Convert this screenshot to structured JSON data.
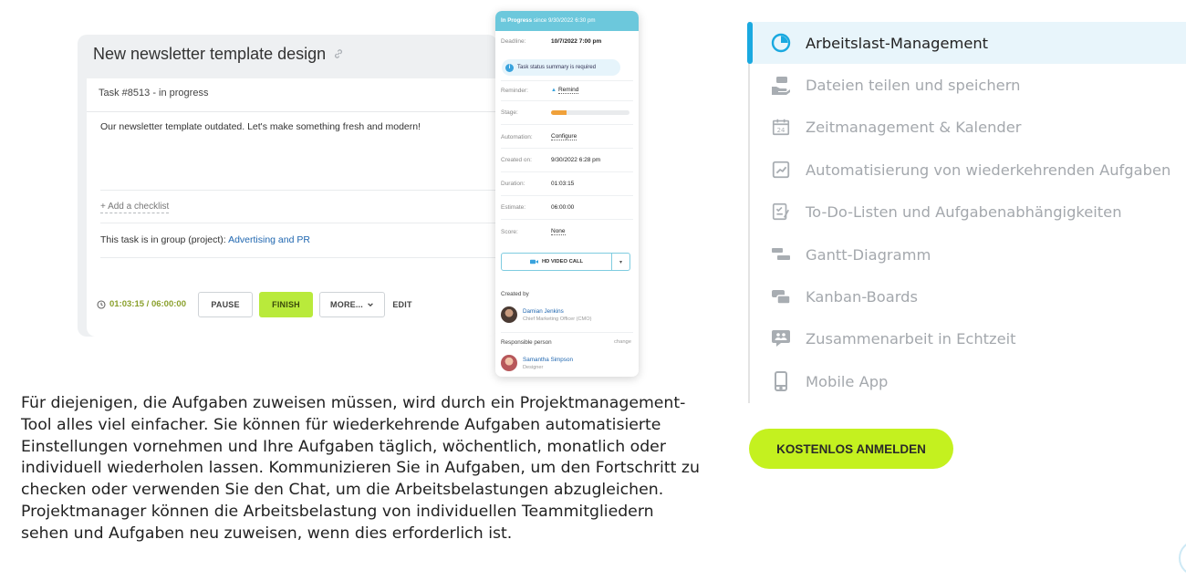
{
  "task": {
    "title": "New newsletter template design",
    "header": "Task #8513 - in progress",
    "description": "Our newsletter template outdated. Let's make something fresh and modern!",
    "add_checklist": "+ Add a checklist",
    "group_prefix": "This task is in group (project):",
    "group_link": "Advertising and PR",
    "timer": "01:03:15 / 06:00:00",
    "buttons": {
      "pause": "PAUSE",
      "finish": "FINISH",
      "more": "MORE...",
      "edit": "EDIT"
    }
  },
  "phone": {
    "status": "In Progress",
    "status_since": "since 9/30/2022 6:30 pm",
    "rows": {
      "deadline_label": "Deadline:",
      "deadline_value": "10/7/2022 7:00 pm",
      "info_pill": "Task status summary is required",
      "reminder_label": "Reminder:",
      "reminder_value": "Remind",
      "stage_label": "Stage:",
      "automation_label": "Automation:",
      "automation_value": "Configure",
      "created_label": "Created on:",
      "created_value": "9/30/2022 6:28 pm",
      "duration_label": "Duration:",
      "duration_value": "01:03:15",
      "estimate_label": "Estimate:",
      "estimate_value": "06:00:00",
      "score_label": "Score:",
      "score_value": "None"
    },
    "stage_progress": 0.2,
    "video_call": "HD VIDEO CALL",
    "created_by_label": "Created by",
    "creator_name": "Damian Jenkins",
    "creator_role": "Chief Marketing Officer (CMO)",
    "responsible_label": "Responsible person",
    "change_label": "change",
    "responsible_name": "Samantha Simpson",
    "responsible_role": "Designer"
  },
  "paragraph": "Für diejenigen, die Aufgaben zuweisen müssen, wird durch ein Projektmanagement-Tool alles viel einfacher. Sie können für wiederkehrende Aufgaben automatisierte Einstellungen vornehmen und Ihre Aufgaben täglich, wöchentlich, monatlich oder individuell wiederholen lassen. Kommunizieren Sie in Aufgaben, um den Fortschritt zu checken oder verwenden Sie den Chat, um die Arbeitsbelastungen abzugleichen. Projektmanager können die Arbeitsbelastung von individuellen Teammitgliedern sehen und Aufgaben neu zuweisen, wenn dies erforderlich ist.",
  "features": [
    {
      "label": "Arbeitslast-Management",
      "icon": "workload-gauge-icon",
      "active": true
    },
    {
      "label": "Dateien teilen und speichern",
      "icon": "file-share-icon",
      "active": false
    },
    {
      "label": "Zeitmanagement & Kalender",
      "icon": "calendar-icon",
      "active": false
    },
    {
      "label": "Automatisierung von wiederkehrenden Aufgaben",
      "icon": "automation-chart-icon",
      "active": false
    },
    {
      "label": "To-Do-Listen und Aufgabenabhängigkeiten",
      "icon": "checklist-icon",
      "active": false
    },
    {
      "label": "Gantt-Diagramm",
      "icon": "gantt-icon",
      "active": false
    },
    {
      "label": "Kanban-Boards",
      "icon": "kanban-icon",
      "active": false
    },
    {
      "label": "Zusammenarbeit in Echtzeit",
      "icon": "collaboration-icon",
      "active": false
    },
    {
      "label": "Mobile App",
      "icon": "mobile-icon",
      "active": false
    }
  ],
  "cta_label": "KOSTENLOS ANMELDEN",
  "colors": {
    "accent_blue": "#1aa9e0",
    "cta_green": "#c4f11f",
    "finish_green": "#b9ea3b",
    "phone_header": "#6cc8dc"
  }
}
